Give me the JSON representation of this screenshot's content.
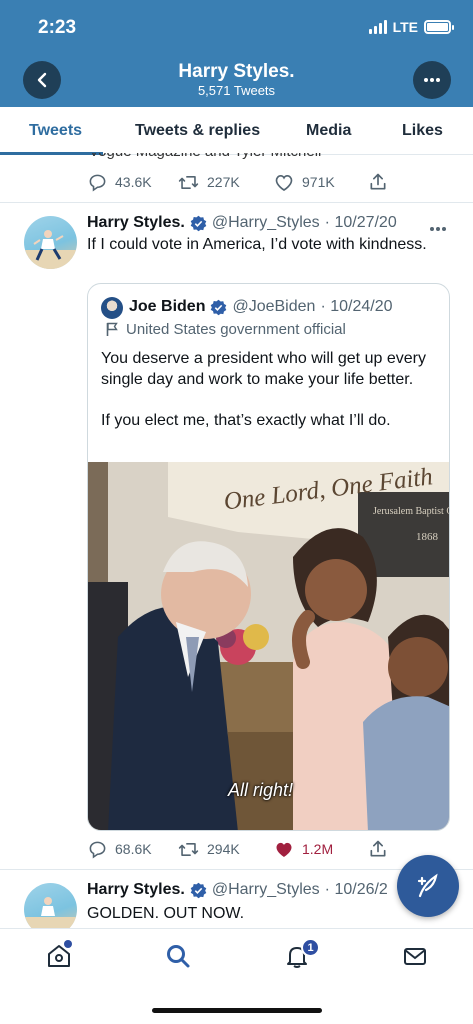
{
  "status_bar": {
    "time": "2:23",
    "network": "LTE"
  },
  "header": {
    "title": "Harry Styles.",
    "subtitle": "5,571 Tweets"
  },
  "tabs": [
    {
      "label": "Tweets",
      "active": true
    },
    {
      "label": "Tweets & replies",
      "active": false
    },
    {
      "label": "Media",
      "active": false
    },
    {
      "label": "Likes",
      "active": false
    }
  ],
  "prev_tweet": {
    "cut_text": "Vogue Magazine and Tyler Mitchell",
    "replies": "43.6K",
    "retweets": "227K",
    "likes": "971K"
  },
  "tweet": {
    "name": "Harry Styles.",
    "handle": "@Harry_Styles",
    "date": "· 10/27/20",
    "text": "If I could vote in America, I’d vote with kindness.",
    "quote": {
      "name": "Joe Biden",
      "handle": "@JoeBiden",
      "date": "· 10/24/20",
      "label": "United States government official",
      "text_1": "You deserve a president who will get up every single day and work to make your life better.",
      "text_2": "If you elect me, that’s exactly what I’ll do.",
      "image_caption": "All right!",
      "image_sign": "One Lord, One Faith",
      "image_sign_small": "Jerusalem Baptist Church",
      "image_sign_year": "1868"
    },
    "replies": "68.6K",
    "retweets": "294K",
    "likes": "1.2M"
  },
  "next_tweet": {
    "name": "Harry Styles.",
    "handle": "@Harry_Styles",
    "date": "· 10/26/2",
    "text": "GOLDEN. OUT NOW."
  },
  "bottom_nav": {
    "notification_count": "1"
  },
  "colors": {
    "header_bg": "#3a7fb3",
    "accent": "#2f6da0",
    "like_red": "#a1203f",
    "verified": "#2f5fa8"
  }
}
